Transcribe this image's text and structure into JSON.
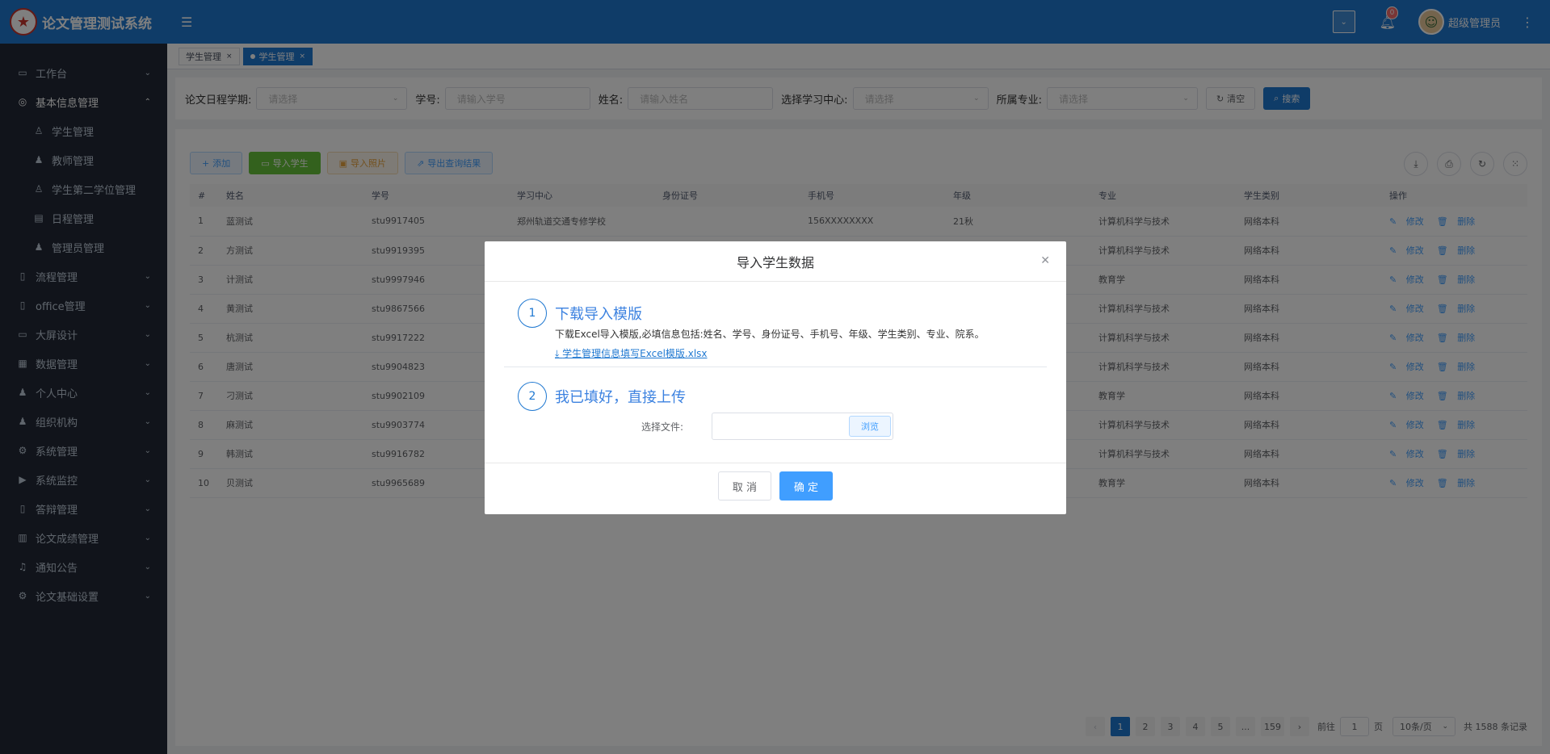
{
  "header": {
    "app_title": "论文管理测试系统",
    "notification_count": "0",
    "username": "超级管理员",
    "colors": {
      "primary": "#1f78d1",
      "sidebar": "#222936"
    }
  },
  "sidebar": {
    "items": [
      {
        "label": "工作台",
        "icon": "monitor-icon"
      },
      {
        "label": "基本信息管理",
        "icon": "globe-icon"
      },
      {
        "label": "学生管理",
        "icon": "user-icon"
      },
      {
        "label": "教师管理",
        "icon": "user-icon"
      },
      {
        "label": "学生第二学位管理",
        "icon": "user-icon"
      },
      {
        "label": "日程管理",
        "icon": "calendar-icon"
      },
      {
        "label": "管理员管理",
        "icon": "user-plus-icon"
      },
      {
        "label": "流程管理",
        "icon": "doc-icon"
      },
      {
        "label": "office管理",
        "icon": "file-icon"
      },
      {
        "label": "大屏设计",
        "icon": "monitor-icon"
      },
      {
        "label": "数据管理",
        "icon": "table-icon"
      },
      {
        "label": "个人中心",
        "icon": "user-icon"
      },
      {
        "label": "组织机构",
        "icon": "team-icon"
      },
      {
        "label": "系统管理",
        "icon": "gear-icon"
      },
      {
        "label": "系统监控",
        "icon": "play-icon"
      },
      {
        "label": "答辩管理",
        "icon": "doc-icon"
      },
      {
        "label": "论文成绩管理",
        "icon": "bar-chart-icon"
      },
      {
        "label": "通知公告",
        "icon": "bell-icon"
      },
      {
        "label": "论文基础设置",
        "icon": "gear-icon"
      }
    ]
  },
  "tabs": [
    {
      "label": "学生管理"
    },
    {
      "label": "学生管理"
    }
  ],
  "search": {
    "term_label": "论文日程学期:",
    "term_placeholder": "请选择",
    "sid_label": "学号:",
    "sid_placeholder": "请输入学号",
    "name_label": "姓名:",
    "name_placeholder": "请输入姓名",
    "center_label": "选择学习中心:",
    "center_placeholder": "请选择",
    "major_label": "所属专业:",
    "major_placeholder": "请选择",
    "clear_label": "清空",
    "search_label": "搜索"
  },
  "toolbar": {
    "add_label": "添加",
    "import_label": "导入学生",
    "photo_label": "导入照片",
    "export_label": "导出查询结果"
  },
  "table": {
    "headers": [
      "#",
      "姓名",
      "学号",
      "学习中心",
      "身份证号",
      "手机号",
      "年级",
      "专业",
      "学生类别",
      "操作"
    ],
    "edit_label": "修改",
    "delete_label": "删除",
    "rows": [
      [
        "1",
        "蓝测试",
        "stu9917405",
        "郑州轨道交通专修学校",
        "",
        "156XXXXXXXX",
        "21秋",
        "计算机科学与技术",
        "网络本科"
      ],
      [
        "2",
        "方测试",
        "stu9919395",
        "",
        "",
        "",
        "",
        "计算机科学与技术",
        "网络本科"
      ],
      [
        "3",
        "计测试",
        "stu9997946",
        "",
        "",
        "",
        "",
        "教育学",
        "网络本科"
      ],
      [
        "4",
        "黄测试",
        "stu9867566",
        "",
        "",
        "",
        "",
        "计算机科学与技术",
        "网络本科"
      ],
      [
        "5",
        "杭测试",
        "stu9917222",
        "",
        "",
        "",
        "",
        "计算机科学与技术",
        "网络本科"
      ],
      [
        "6",
        "唐测试",
        "stu9904823",
        "",
        "",
        "",
        "",
        "计算机科学与技术",
        "网络本科"
      ],
      [
        "7",
        "刁测试",
        "stu9902109",
        "",
        "",
        "",
        "",
        "教育学",
        "网络本科"
      ],
      [
        "8",
        "麻测试",
        "stu9903774",
        "",
        "",
        "",
        "",
        "计算机科学与技术",
        "网络本科"
      ],
      [
        "9",
        "韩测试",
        "stu9916782",
        "",
        "",
        "",
        "",
        "计算机科学与技术",
        "网络本科"
      ],
      [
        "10",
        "贝测试",
        "stu9965689",
        "",
        "",
        "",
        "",
        "教育学",
        "网络本科"
      ]
    ]
  },
  "pagination": {
    "pages": [
      "1",
      "2",
      "3",
      "4",
      "5",
      "...",
      "159"
    ],
    "goto_label": "前往",
    "goto_value": "1",
    "page_unit": "页",
    "page_size": "10条/页",
    "total": "共 1588 条记录"
  },
  "dialog": {
    "title": "导入学生数据",
    "step1_num": "1",
    "step1_title": "下载导入模版",
    "step1_desc": "下载Excel导入模版,必填信息包括:姓名、学号、身份证号、手机号、年级、学生类别、专业、院系。",
    "step1_link": "学生管理信息填写Excel模版.xlsx",
    "step2_num": "2",
    "step2_title": "我已填好，直接上传",
    "file_label": "选择文件:",
    "browse_label": "浏览",
    "cancel_label": "取 消",
    "ok_label": "确 定"
  }
}
